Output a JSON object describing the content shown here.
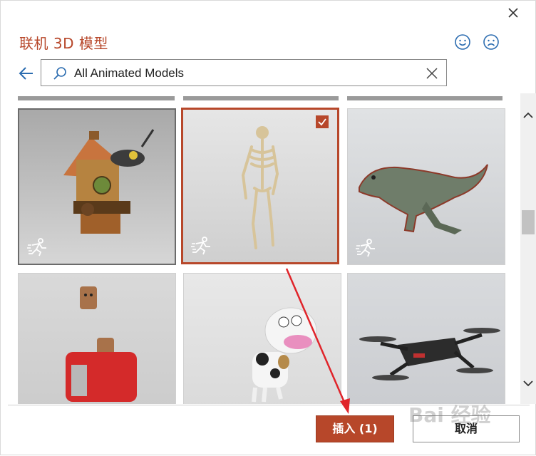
{
  "dialog": {
    "title": "联机 3D 模型",
    "search": {
      "value": "All Animated Models"
    },
    "buttons": {
      "insert_label": "插入 (1)",
      "cancel_label": "取消"
    }
  },
  "colors": {
    "accent": "#b7472a",
    "icon_blue": "#2b6cb0"
  },
  "icons": {
    "close": "close-icon",
    "smile": "smile-icon",
    "frown": "frown-icon",
    "back": "back-arrow-icon",
    "search": "search-icon",
    "clear": "clear-icon",
    "animated": "animated-running-icon",
    "check": "checkbox-checked-icon"
  },
  "models": [
    {
      "id": "cuckoo-clock",
      "selected": false,
      "animated": true
    },
    {
      "id": "skeleton",
      "selected": true,
      "animated": true
    },
    {
      "id": "t-rex",
      "selected": false,
      "animated": true
    },
    {
      "id": "toaster",
      "selected": false,
      "animated": false
    },
    {
      "id": "cow",
      "selected": false,
      "animated": false
    },
    {
      "id": "drone",
      "selected": false,
      "animated": false
    }
  ],
  "watermark": {
    "text": "Bai 经验"
  }
}
